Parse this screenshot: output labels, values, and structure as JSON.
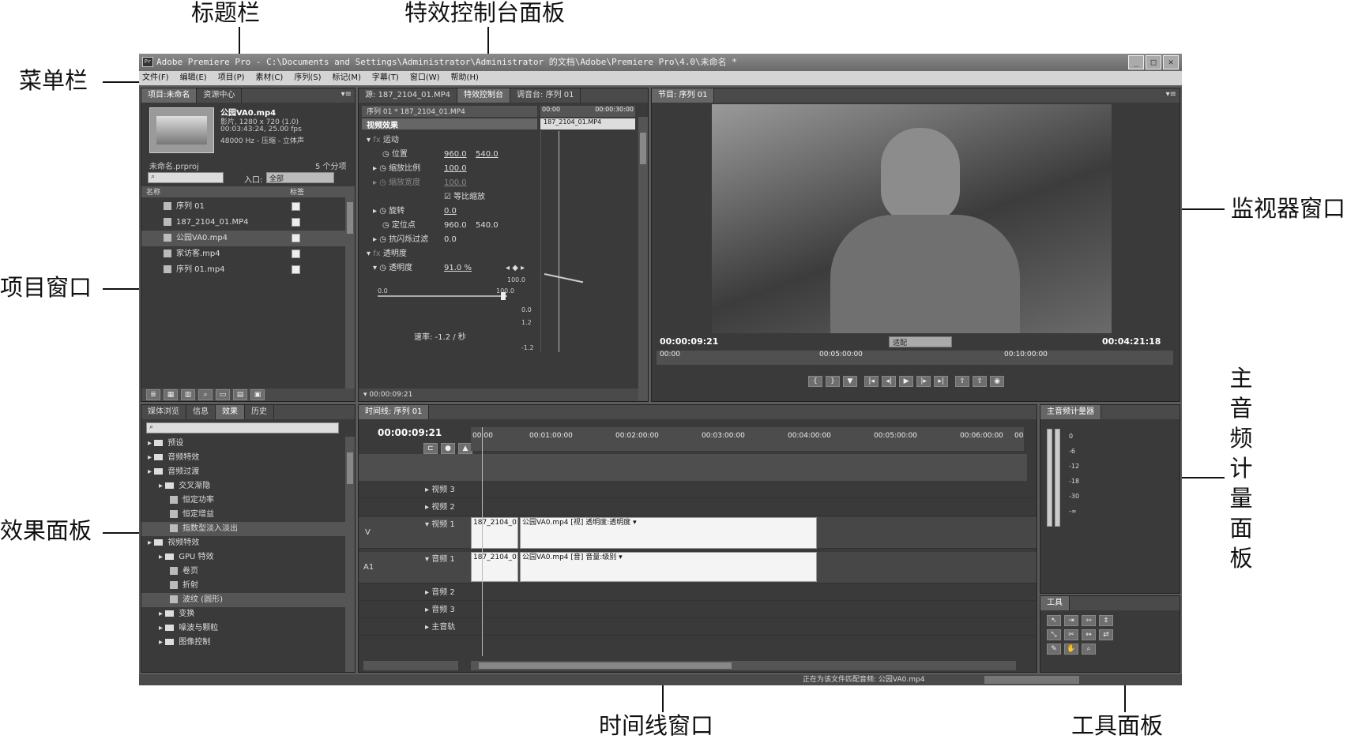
{
  "callouts": {
    "title_bar": "标题栏",
    "effect_controls_panel": "特效控制台面板",
    "menu_bar": "菜单栏",
    "monitor_window": "监视器窗口",
    "project_window": "项目窗口",
    "master_audio_meter": "主音频计量面板",
    "effects_panel": "效果面板",
    "timeline_window": "时间线窗口",
    "tools_panel": "工具面板"
  },
  "window": {
    "title": "Adobe Premiere Pro - C:\\Documents and Settings\\Administrator\\Administrator 的文档\\Adobe\\Premiere Pro\\4.0\\未命名 *",
    "app_icon": "Pr"
  },
  "menu": [
    "文件(F)",
    "编辑(E)",
    "项目(P)",
    "素材(C)",
    "序列(S)",
    "标记(M)",
    "字幕(T)",
    "窗口(W)",
    "帮助(H)"
  ],
  "project": {
    "tabs": [
      "项目:未命名",
      "资源中心"
    ],
    "clip_name": "公园VA0.mp4",
    "clip_info": [
      "影片, 1280 x 720 (1.0)",
      "00:03:43:24, 25.00 fps",
      "48000 Hz - 压缩 - 立体声"
    ],
    "project_file": "未命名.prproj",
    "item_count": "5 个分项",
    "in_label": "入口:",
    "in_value": "全部",
    "col_name": "名称",
    "col_label": "标签",
    "items": [
      "序列 01",
      "187_2104_01.MP4",
      "公园VA0.mp4",
      "家访客.mp4",
      "序列 01.mp4"
    ]
  },
  "effect_controls": {
    "tabs": [
      "源: 187_2104_01.MP4",
      "特效控制台",
      "调音台: 序列 01"
    ],
    "header": "序列 01 * 187_2104_01.MP4",
    "clip_label": "187_2104_01.MP4",
    "ruler_start": "00:00",
    "ruler_end": "00:00:30:00",
    "section": "视频效果",
    "motion": "运动",
    "position_label": "位置",
    "position_x": "960.0",
    "position_y": "540.0",
    "scale_label": "缩放比例",
    "scale_value": "100.0",
    "scale_width_label": "缩放宽度",
    "scale_width_value": "100.0",
    "uniform_scale": "等比缩放",
    "rotation_label": "旋转",
    "rotation_value": "0.0",
    "anchor_label": "定位点",
    "anchor_x": "960.0",
    "anchor_y": "540.0",
    "antiflicker_label": "抗闪烁过滤",
    "antiflicker_value": "0.0",
    "opacity_section": "透明度",
    "opacity_label": "透明度",
    "opacity_value": "91.0 %",
    "graph_labels": [
      "100.0",
      "0.0",
      "100.0",
      "0.0",
      "1.2",
      "-1.2"
    ],
    "velocity": "速率: -1.2 / 秒",
    "timecode": "00:00:09:21"
  },
  "monitor": {
    "tab": "节目: 序列 01",
    "timecode_left": "00:00:09:21",
    "fit": "适配",
    "timecode_right": "00:04:21:18",
    "ruler": [
      "00:00",
      "00:05:00:00",
      "00:10:00:00"
    ]
  },
  "effects": {
    "tabs": [
      "媒体浏览",
      "信息",
      "效果",
      "历史"
    ],
    "tree": [
      {
        "label": "预设",
        "level": 0
      },
      {
        "label": "音频特效",
        "level": 0
      },
      {
        "label": "音频过渡",
        "level": 0
      },
      {
        "label": "交叉渐隐",
        "level": 1
      },
      {
        "label": "恒定功率",
        "level": 2
      },
      {
        "label": "恒定增益",
        "level": 2
      },
      {
        "label": "指数型淡入淡出",
        "level": 2
      },
      {
        "label": "视频特效",
        "level": 0
      },
      {
        "label": "GPU 特效",
        "level": 1
      },
      {
        "label": "卷页",
        "level": 2
      },
      {
        "label": "折射",
        "level": 2
      },
      {
        "label": "波纹 (圆形)",
        "level": 2
      },
      {
        "label": "变换",
        "level": 1
      },
      {
        "label": "噪波与颗粒",
        "level": 1
      },
      {
        "label": "图像控制",
        "level": 1
      }
    ]
  },
  "timeline": {
    "tab": "时间线: 序列 01",
    "timecode": "00:00:09:21",
    "ruler": [
      "00:00",
      "00:01:00:00",
      "00:02:00:00",
      "00:03:00:00",
      "00:04:00:00",
      "00:05:00:00",
      "00:06:00:00",
      "00"
    ],
    "video_tracks": [
      "视频 3",
      "视频 2",
      "视频 1"
    ],
    "audio_tracks": [
      "音频 1",
      "音频 2",
      "音频 3",
      "主音轨"
    ],
    "v_label": "V",
    "a_label": "A1",
    "video_clip_a": "187_2104_01",
    "video_clip_b": "公园VA0.mp4 [视] 透明度:透明度 ▾",
    "audio_clip_a": "187_2104_01",
    "audio_clip_b": "公园VA0.mp4 [音] 音量:级别 ▾"
  },
  "meter": {
    "tab": "主音频计量器",
    "scale": [
      "0",
      "-6",
      "-12",
      "-18",
      "-30",
      "-∞"
    ]
  },
  "tools": {
    "tab": "工具"
  },
  "status": {
    "text": "正在为该文件匹配音频: 公园VA0.mp4"
  }
}
